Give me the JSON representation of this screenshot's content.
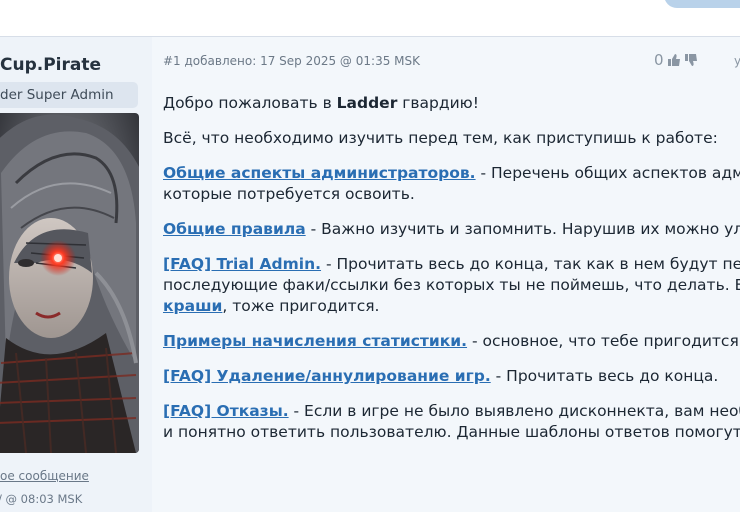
{
  "author": {
    "name": "Cup.Pirate",
    "rank": "der Super Admin",
    "last_message_link": "ое сообщение",
    "last_message_time": "/ @ 08:03 MSK"
  },
  "post": {
    "meta": "#1 добавлено: 17 Sep 2025 @ 01:35 MSK",
    "vote_count": "0",
    "more_letter": "у",
    "greeting_prefix": "Добро пожаловать в ",
    "greeting_bold": "Ladder",
    "greeting_suffix": " гвардию!",
    "intro": "Всё, что необходимо изучить перед тем, как приступишь к работе:",
    "items": [
      {
        "link": "Общие аспекты администраторов.",
        "text": " - Перечень общих аспектов админ",
        "text2": "которые потребуется освоить."
      },
      {
        "link": "Общие правила",
        "text": " - Важно изучить и запомнить. Нарушив их можно улете"
      },
      {
        "link": "[FAQ] Trial Admin.",
        "text": " - Прочитать весь до конца, так как в нем будут перех",
        "text2": "последующие факи/ссылки без которых ты не поймешь, что делать. Еш",
        "link3": "краши",
        "text3": ", тоже пригодится."
      },
      {
        "link": "Примеры начисления статистики.",
        "text": " - основное, что тебе пригодится."
      },
      {
        "link": "[FAQ] Удаление/аннулирование игр.",
        "text": " - Прочитать весь до конца."
      },
      {
        "link": "[FAQ] Отказы.",
        "text": " - Если в игре не было выявлено дисконнекта, вам необх",
        "text2": "и понятно ответить пользователю. Данные шаблоны ответов помогут"
      }
    ]
  }
}
